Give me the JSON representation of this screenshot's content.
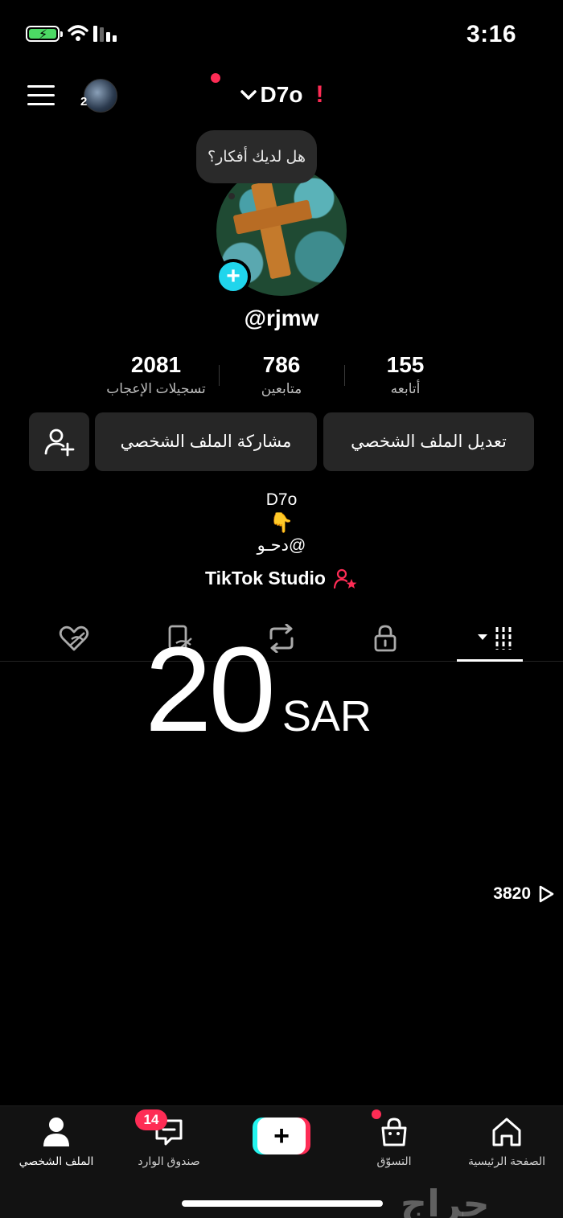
{
  "status_bar": {
    "time": "3:16",
    "battery_bolt": "⚡"
  },
  "header": {
    "avatar_count": "2",
    "account_name": "D7o",
    "warning_mark": "!",
    "chevron": "⌄"
  },
  "profile": {
    "thought_bubble": "هل لديك أفكار؟",
    "avatar_add": "+",
    "username": "@rjmw",
    "stats": {
      "likes": {
        "value": "2081",
        "label": "تسجيلات الإعجاب"
      },
      "followers": {
        "value": "786",
        "label": "متابعين"
      },
      "following": {
        "value": "155",
        "label": "أتابعه"
      }
    },
    "buttons": {
      "edit": "تعديل الملف الشخصي",
      "share": "مشاركة الملف الشخصي"
    },
    "bio": {
      "line1": "D7o",
      "line2": "👇",
      "line3": "@دحـو"
    },
    "studio_link": "TikTok Studio"
  },
  "tabs": [
    "videos",
    "private",
    "reposts",
    "favorites",
    "liked"
  ],
  "overlay": {
    "price": "20",
    "currency": "SAR"
  },
  "video": {
    "views": "3820"
  },
  "bottom_nav": {
    "home": "الصفحة الرئيسية",
    "shop": "التسوّق",
    "create": "+",
    "inbox": "صندوق الوارد",
    "inbox_badge": "14",
    "profile": "الملف الشخصي"
  },
  "watermark": "حراج",
  "colors": {
    "accent": "#fe2c55",
    "cyan": "#25f4ee",
    "button_bg": "#262626"
  }
}
